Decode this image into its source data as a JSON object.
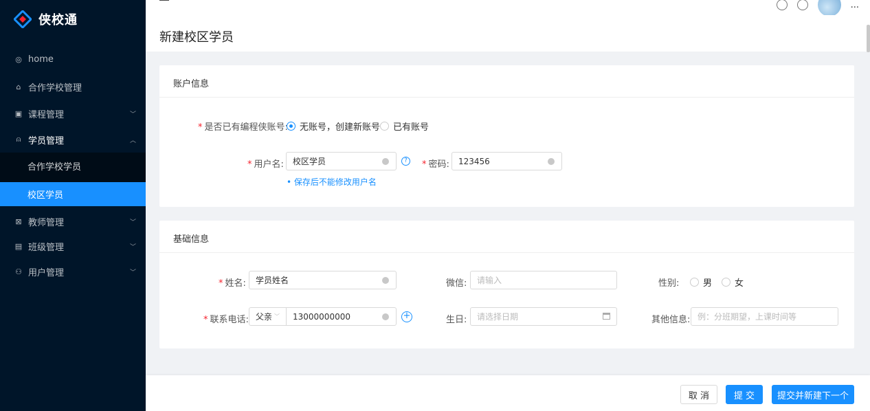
{
  "app": {
    "name": "侠校通"
  },
  "header": {
    "username": "..."
  },
  "page": {
    "title": "新建校区学员"
  },
  "sidebar": {
    "items": [
      {
        "label": "home",
        "icon": "home-icon"
      },
      {
        "label": "合作学校管理",
        "icon": "school-icon"
      },
      {
        "label": "课程管理",
        "icon": "course-icon"
      },
      {
        "label": "学员管理",
        "icon": "student-icon"
      },
      {
        "label": "教师管理",
        "icon": "teacher-icon"
      },
      {
        "label": "班级管理",
        "icon": "class-icon"
      },
      {
        "label": "用户管理",
        "icon": "user-icon"
      }
    ],
    "subitems": [
      {
        "label": "合作学校学员"
      },
      {
        "label": "校区学员"
      }
    ]
  },
  "account": {
    "title": "账户信息",
    "has_account_label": "是否已有编程侠账号:",
    "option_no": "无账号，创建新账号",
    "option_yes": "已有账号",
    "username_label": "用户名:",
    "username_value": "校区学员",
    "password_label": "密码:",
    "password_value": "123456",
    "hint": "保存后不能修改用户名"
  },
  "basic": {
    "title": "基础信息",
    "name_label": "姓名:",
    "name_value": "学员姓名",
    "wechat_label": "微信:",
    "wechat_placeholder": "请输入",
    "gender_label": "性别:",
    "gender_male": "男",
    "gender_female": "女",
    "phone_label": "联系电话:",
    "relation_value": "父亲",
    "phone_value": "13000000000",
    "birthday_label": "生日:",
    "birthday_placeholder": "请选择日期",
    "other_label": "其他信息:",
    "other_placeholder": "例：分班期望，上课时间等"
  },
  "footer": {
    "cancel": "取 消",
    "submit": "提 交",
    "submit_next": "提交并新建下一个"
  },
  "colors": {
    "primary": "#1890ff",
    "sidebar": "#001529",
    "required": "#f5222d"
  }
}
